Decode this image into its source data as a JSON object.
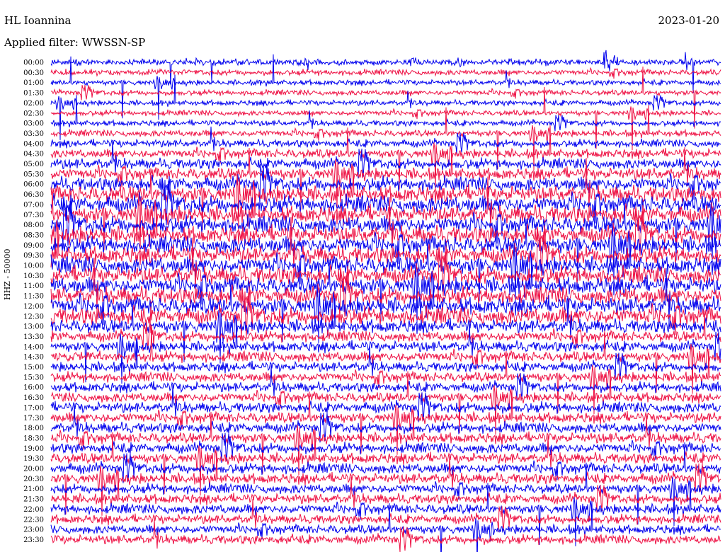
{
  "header": {
    "station": "HL Ioannina",
    "filter": "Applied filter: WWSSN-SP",
    "date": "2023-01-20",
    "channel_label": "HHZ - 50000"
  },
  "colors": {
    "trace_a": "#0000ee",
    "trace_b": "#ee1144",
    "background": "#ffffff"
  },
  "chart_data": {
    "type": "line",
    "title": "HL Ioannina",
    "subtitle": "Applied filter: WWSSN-SP",
    "date": "2023-01-20",
    "ylabel": "HHZ - 50000",
    "rows": [
      "00:00",
      "00:30",
      "01:00",
      "01:30",
      "02:00",
      "02:30",
      "03:00",
      "03:30",
      "04:00",
      "04:30",
      "05:00",
      "05:30",
      "06:00",
      "06:30",
      "07:00",
      "07:30",
      "08:00",
      "08:30",
      "09:00",
      "09:30",
      "10:00",
      "10:30",
      "11:00",
      "11:30",
      "12:00",
      "12:30",
      "13:00",
      "13:30",
      "14:00",
      "14:30",
      "15:00",
      "15:30",
      "16:00",
      "16:30",
      "17:00",
      "17:30",
      "18:00",
      "18:30",
      "19:00",
      "19:30",
      "20:00",
      "20:30",
      "21:00",
      "21:30",
      "22:00",
      "22:30",
      "23:00",
      "23:30"
    ],
    "series_colors": [
      "#0000ee",
      "#ee1144"
    ],
    "relative_noise_amplitude": [
      0.25,
      0.22,
      0.2,
      0.2,
      0.2,
      0.2,
      0.22,
      0.28,
      0.35,
      0.45,
      0.55,
      0.65,
      0.8,
      0.95,
      1.0,
      1.0,
      1.0,
      1.0,
      1.0,
      1.0,
      1.0,
      1.0,
      1.0,
      1.0,
      1.0,
      1.0,
      0.75,
      0.55,
      0.55,
      0.55,
      0.5,
      0.5,
      0.5,
      0.5,
      0.55,
      0.55,
      0.55,
      0.55,
      0.55,
      0.55,
      0.55,
      0.55,
      0.5,
      0.5,
      0.5,
      0.45,
      0.45,
      0.45
    ],
    "grid": false
  }
}
